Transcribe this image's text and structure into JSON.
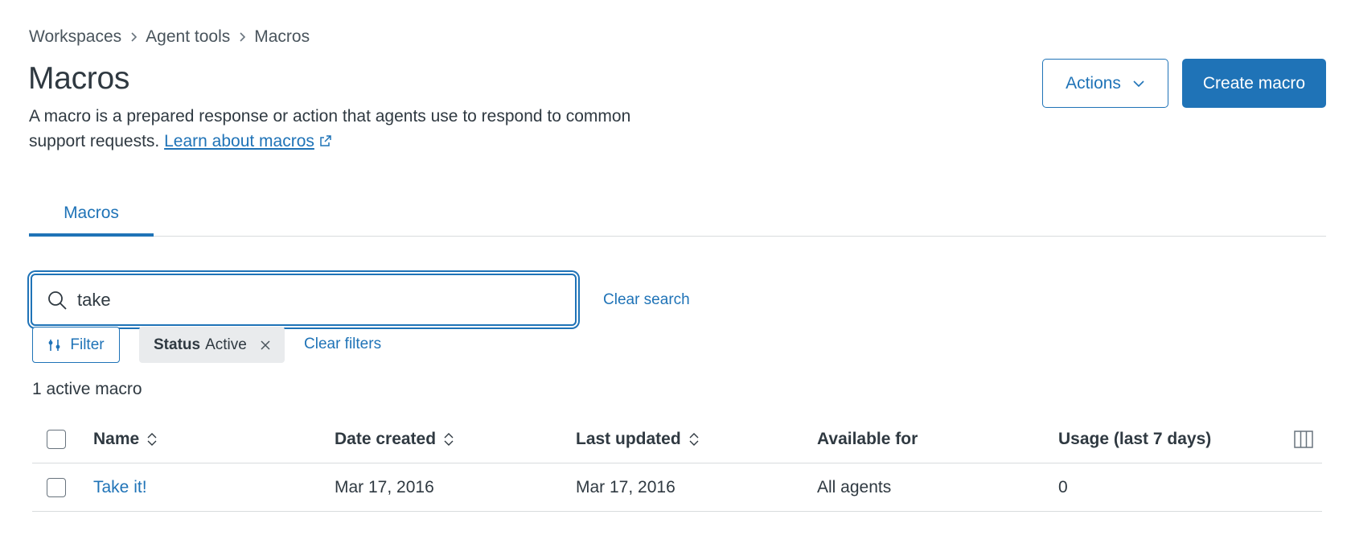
{
  "breadcrumb": [
    "Workspaces",
    "Agent tools",
    "Macros"
  ],
  "page": {
    "title": "Macros",
    "description": "A macro is a prepared response or action that agents use to respond to common support requests.",
    "learn_link": "Learn about macros"
  },
  "header_buttons": {
    "actions_label": "Actions",
    "create_label": "Create macro"
  },
  "tabs": [
    {
      "label": "Macros",
      "active": true
    }
  ],
  "search": {
    "value": "take",
    "clear_label": "Clear search"
  },
  "filters": {
    "filter_label": "Filter",
    "tag_key": "Status",
    "tag_value": "Active",
    "clear_label": "Clear filters"
  },
  "count_text": "1 active macro",
  "table": {
    "columns": [
      "Name",
      "Date created",
      "Last updated",
      "Available for",
      "Usage (last 7 days)"
    ],
    "rows": [
      {
        "name": "Take it!",
        "date_created": "Mar 17, 2016",
        "last_updated": "Mar 17, 2016",
        "available_for": "All agents",
        "usage": "0"
      }
    ]
  },
  "colors": {
    "accent": "#1f73b7",
    "text": "#2f3941",
    "border": "#d8dcde",
    "tag_bg": "#e9ebed"
  },
  "icons": [
    "chevron-right-icon",
    "external-link-icon",
    "chevron-down-icon",
    "search-icon",
    "filter-sliders-icon",
    "close-icon",
    "sort-icon",
    "columns-icon"
  ]
}
